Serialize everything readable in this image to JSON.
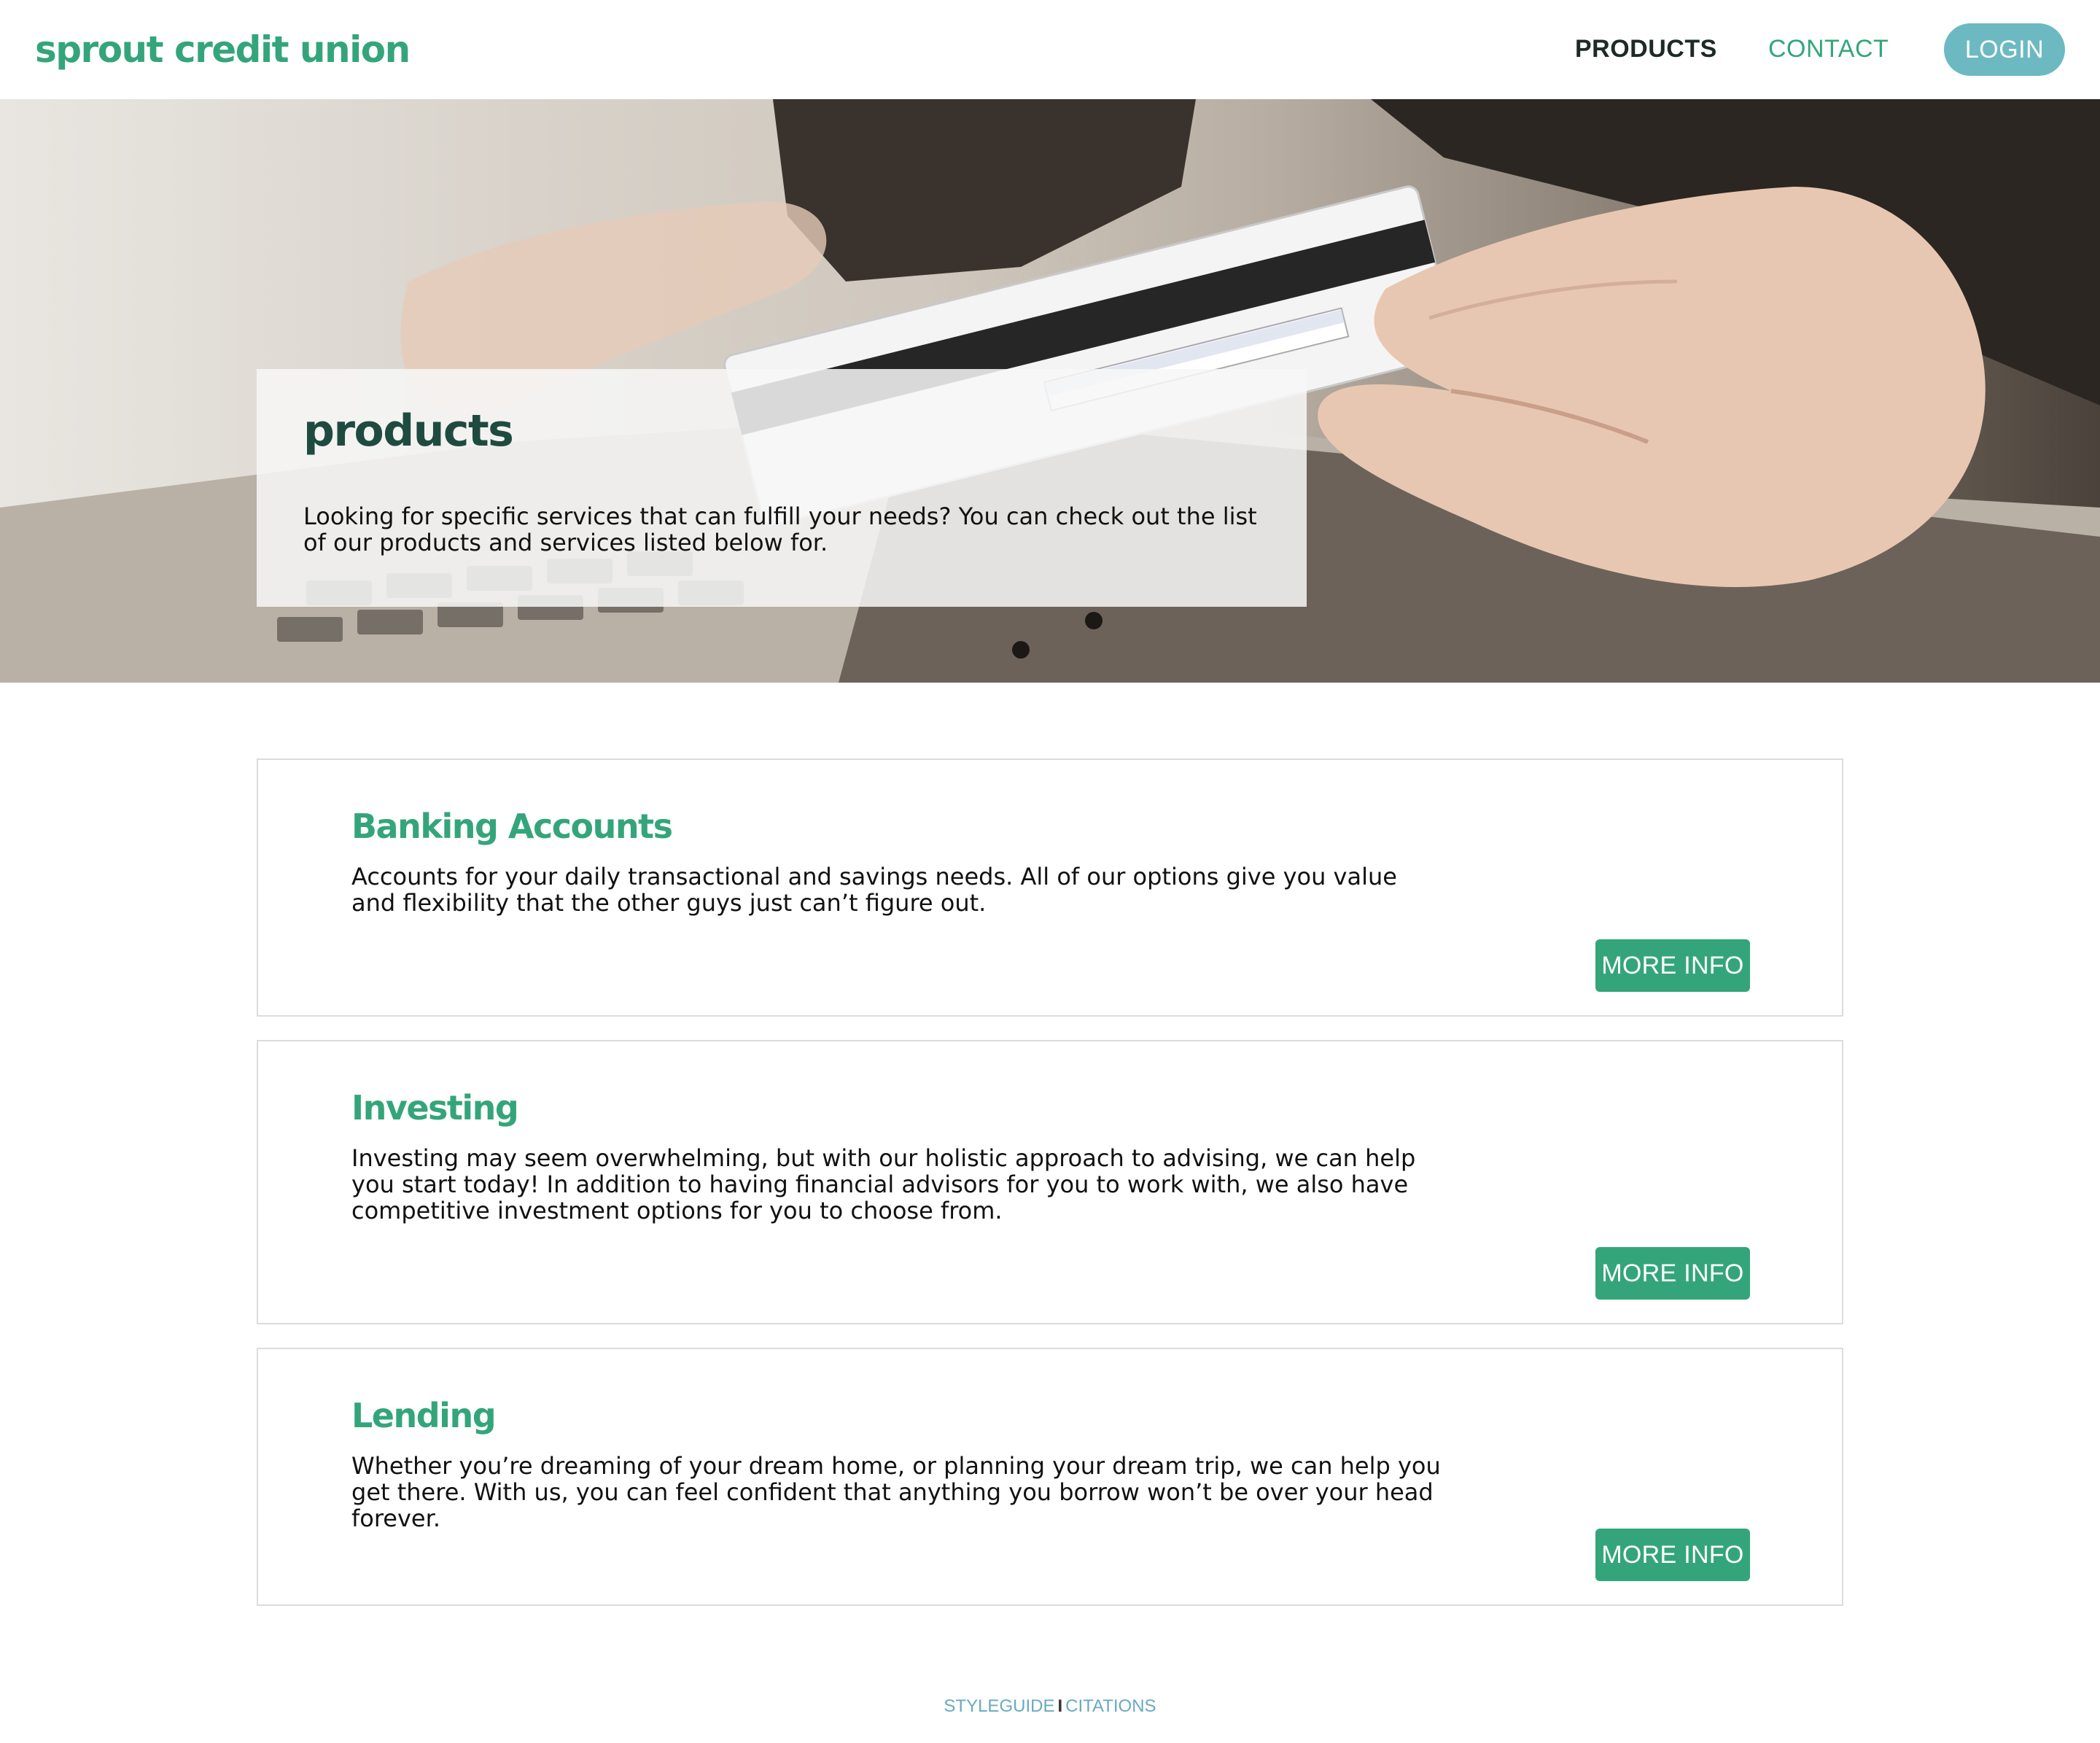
{
  "brand": {
    "name": "sprout credit union",
    "primary_color": "#34a57a",
    "accent_color": "#6db9c2"
  },
  "nav": {
    "products_label": "PRODUCTS",
    "contact_label": "CONTACT",
    "login_label": "LOGIN"
  },
  "hero": {
    "title": "products",
    "text": "Looking for specific services that can fulfill your needs? You can check out the list of our products and services listed below for."
  },
  "products": [
    {
      "title": "Banking Accounts",
      "text": "Accounts for your daily transactional and savings needs. All of our options give you value and flexibility that the other guys just can’t figure out.",
      "button": "MORE INFO"
    },
    {
      "title": "Investing",
      "text": "Investing may seem overwhelming, but with our holistic approach to advising, we can help you start today! In addition to having financial advisors for you to work with, we also have competitive investment options for you to choose from.",
      "button": "MORE INFO"
    },
    {
      "title": "Lending",
      "text": "Whether you’re dreaming of your dream home, or planning your dream trip, we can help you get there. With us, you can feel confident that anything you borrow won’t be over your head forever.",
      "button": "MORE INFO"
    }
  ],
  "footer": {
    "styleguide_label": "STYLEGUIDE",
    "separator": "I",
    "citations_label": "CITATIONS"
  }
}
